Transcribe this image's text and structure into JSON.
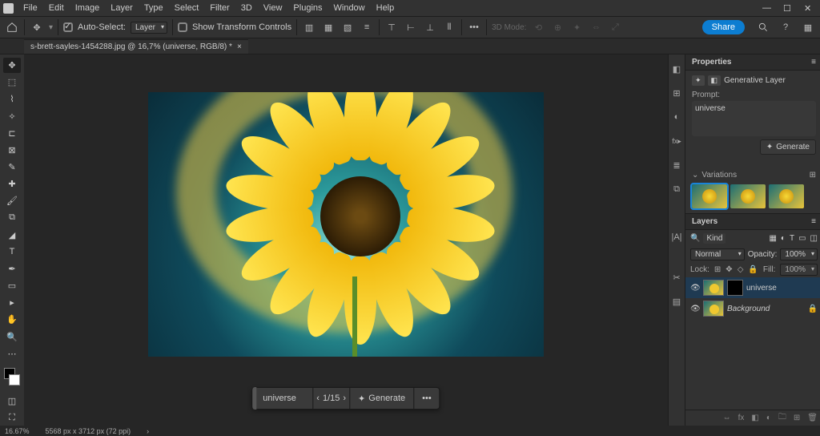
{
  "menu": {
    "items": [
      "File",
      "Edit",
      "Image",
      "Layer",
      "Type",
      "Select",
      "Filter",
      "3D",
      "View",
      "Plugins",
      "Window",
      "Help"
    ]
  },
  "optbar": {
    "auto_select": "Auto-Select:",
    "auto_select_target": "Layer",
    "show_transform": "Show Transform Controls",
    "mode3d": "3D Mode:",
    "share": "Share"
  },
  "doc": {
    "tab_title": "s-brett-sayles-1454288.jpg @ 16,7% (universe, RGB/8) *"
  },
  "genbar": {
    "prompt_value": "universe",
    "page": "1/15",
    "generate": "Generate"
  },
  "properties": {
    "title": "Properties",
    "layer_type": "Generative Layer",
    "prompt_label": "Prompt:",
    "prompt_value": "universe",
    "generate_btn": "Generate",
    "variations_label": "Variations"
  },
  "layers": {
    "title": "Layers",
    "kind": "Kind",
    "blend": "Normal",
    "opacity_label": "Opacity:",
    "opacity_value": "100%",
    "lock_label": "Lock:",
    "fill_label": "Fill:",
    "fill_value": "100%",
    "items": [
      {
        "name": "universe",
        "has_mask": true,
        "italic": false
      },
      {
        "name": "Background",
        "has_mask": false,
        "italic": true
      }
    ]
  },
  "status": {
    "zoom": "16.67%",
    "dims": "5568 px x 3712 px (72 ppi)"
  }
}
